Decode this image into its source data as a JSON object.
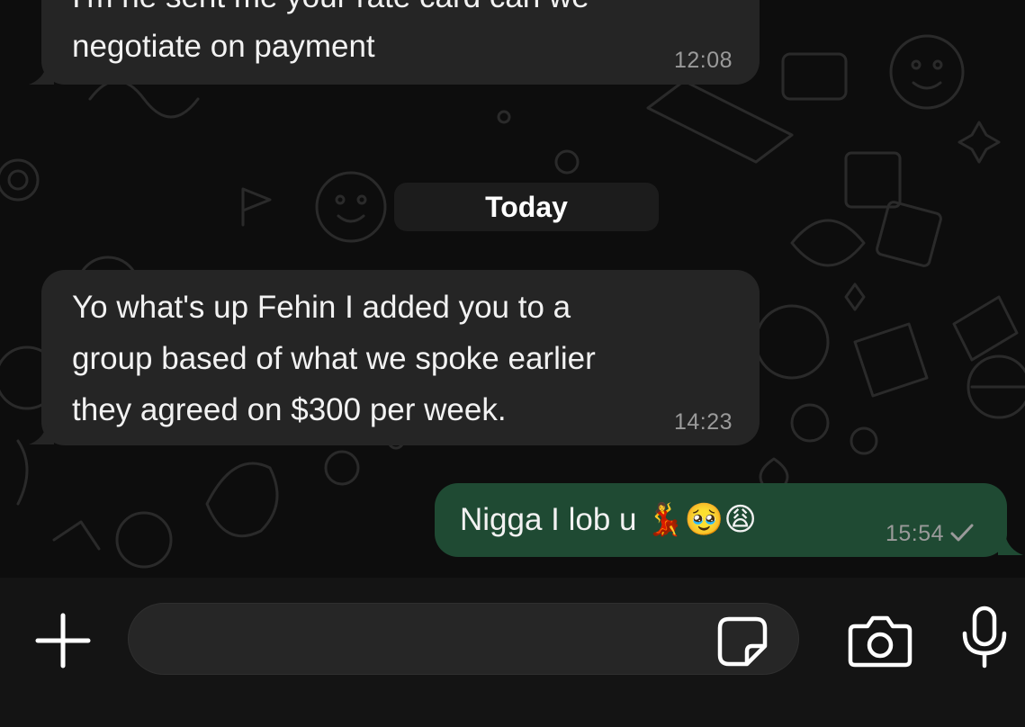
{
  "messages": [
    {
      "direction": "incoming",
      "lines": [
        "I'm he sent me your rate card can we",
        "negotiate on payment"
      ],
      "time": "12:08"
    },
    {
      "direction": "incoming",
      "lines": [
        "Yo what's up Fehin I added you to a",
        "group based of what we spoke earlier",
        "they agreed on $300 per week."
      ],
      "time": "14:23"
    },
    {
      "direction": "outgoing",
      "text": "Nigga I lob u 💃🥹😩",
      "time": "15:54",
      "status": "sent-check-icon"
    }
  ],
  "date_divider": "Today",
  "composer": {
    "placeholder": "",
    "icons": [
      "plus-icon",
      "sticker-icon",
      "camera-icon",
      "microphone-icon"
    ]
  },
  "colors": {
    "background": "#0d0d0d",
    "incoming_bubble": "#252525",
    "outgoing_bubble": "#1f4a33",
    "timestamp": "#9a9a9a"
  }
}
